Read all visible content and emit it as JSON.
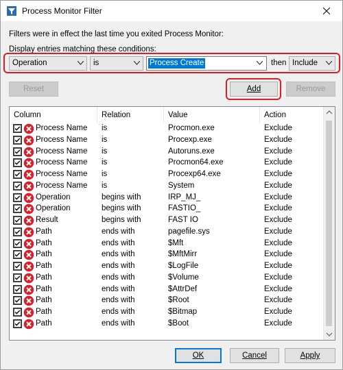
{
  "window": {
    "title": "Process Monitor Filter"
  },
  "intro": {
    "line1": "Filters were in effect the last time you exited Process Monitor:",
    "line2": "Display entries matching these conditions:"
  },
  "condition": {
    "column": "Operation",
    "relation": "is",
    "value": "Process Create",
    "then_label": "then",
    "action": "Include"
  },
  "buttons": {
    "reset": "Reset",
    "add": "Add",
    "remove": "Remove",
    "ok": "OK",
    "cancel": "Cancel",
    "apply": "Apply"
  },
  "table": {
    "headers": [
      "Column",
      "Relation",
      "Value",
      "Action"
    ],
    "rows": [
      [
        "Process Name",
        "is",
        "Procmon.exe",
        "Exclude"
      ],
      [
        "Process Name",
        "is",
        "Procexp.exe",
        "Exclude"
      ],
      [
        "Process Name",
        "is",
        "Autoruns.exe",
        "Exclude"
      ],
      [
        "Process Name",
        "is",
        "Procmon64.exe",
        "Exclude"
      ],
      [
        "Process Name",
        "is",
        "Procexp64.exe",
        "Exclude"
      ],
      [
        "Process Name",
        "is",
        "System",
        "Exclude"
      ],
      [
        "Operation",
        "begins with",
        "IRP_MJ_",
        "Exclude"
      ],
      [
        "Operation",
        "begins with",
        "FASTIO_",
        "Exclude"
      ],
      [
        "Result",
        "begins with",
        "FAST IO",
        "Exclude"
      ],
      [
        "Path",
        "ends with",
        "pagefile.sys",
        "Exclude"
      ],
      [
        "Path",
        "ends with",
        "$Mft",
        "Exclude"
      ],
      [
        "Path",
        "ends with",
        "$MftMirr",
        "Exclude"
      ],
      [
        "Path",
        "ends with",
        "$LogFile",
        "Exclude"
      ],
      [
        "Path",
        "ends with",
        "$Volume",
        "Exclude"
      ],
      [
        "Path",
        "ends with",
        "$AttrDef",
        "Exclude"
      ],
      [
        "Path",
        "ends with",
        "$Root",
        "Exclude"
      ],
      [
        "Path",
        "ends with",
        "$Bitmap",
        "Exclude"
      ],
      [
        "Path",
        "ends with",
        "$Boot",
        "Exclude"
      ]
    ]
  },
  "colors": {
    "highlight": "#e01b24",
    "selection": "#0078d7",
    "exclude_icon": "#d9202a"
  }
}
